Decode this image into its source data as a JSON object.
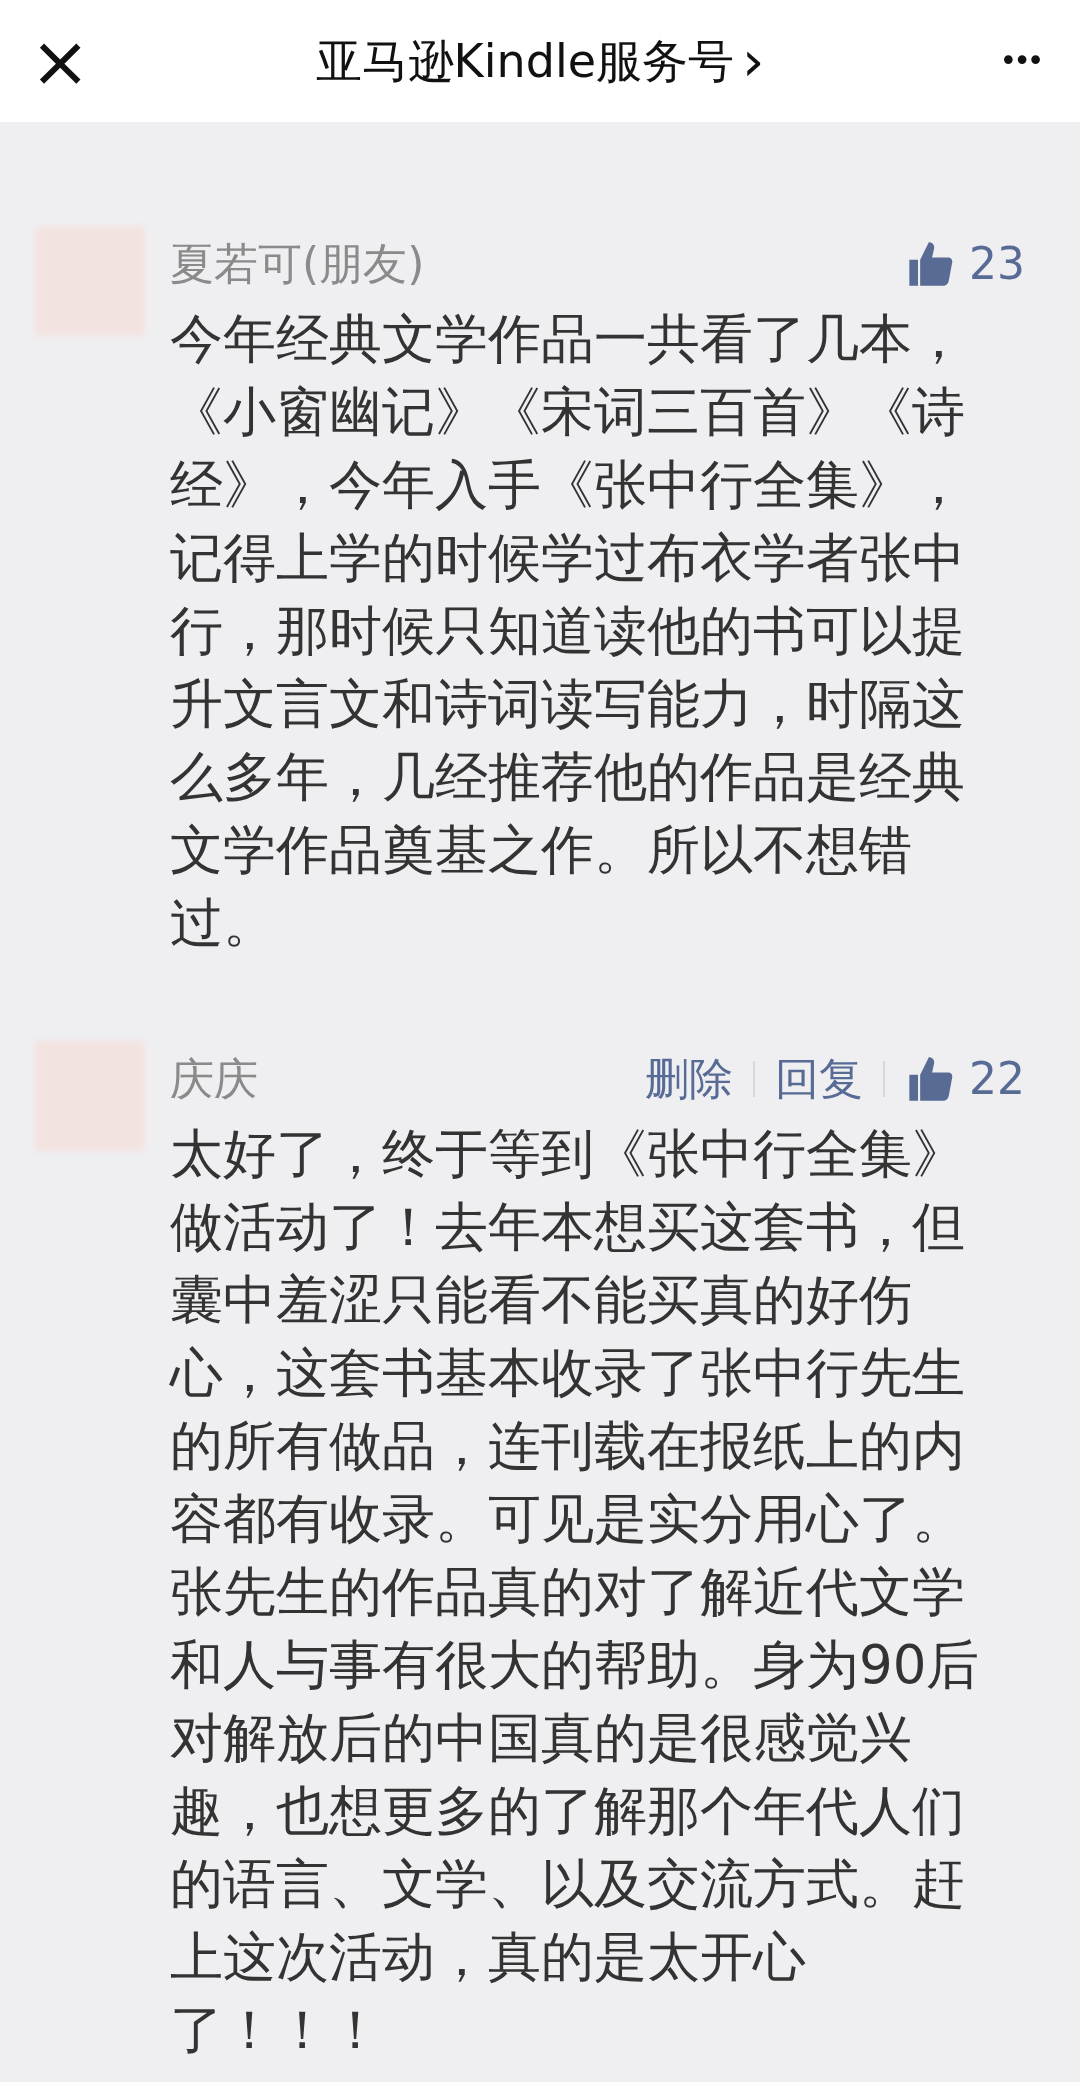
{
  "header": {
    "close": "×",
    "title": "亚马逊Kindle服务号",
    "chevron": "›",
    "more": "•••"
  },
  "comments": [
    {
      "name": "夏若可(朋友)",
      "likes": "23",
      "text": "今年经典文学作品一共看了几本，《小窗幽记》《宋词三百首》《诗经》，今年入手《张中行全集》，记得上学的时候学过布衣学者张中行，那时候只知道读他的书可以提升文言文和诗词读写能力，时隔这么多年，几经推荐他的作品是经典文学作品奠基之作。所以不想错过。"
    },
    {
      "name": "庆庆",
      "actions": [
        "删除",
        "回复"
      ],
      "likes": "22",
      "text": "太好了，终于等到《张中行全集》做活动了！去年本想买这套书，但囊中羞涩只能看不能买真的好伤心，这套书基本收录了张中行先生的所有做品，连刊载在报纸上的内容都有收录。可见是实分用心了。张先生的作品真的对了解近代文学和人与事有很大的帮助。身为90后对解放后的中国真的是很感觉兴趣，也想更多的了解那个年代人们的语言、文学、以及交流方式。赶上这次活动，真的是太开心了！！！"
    }
  ]
}
